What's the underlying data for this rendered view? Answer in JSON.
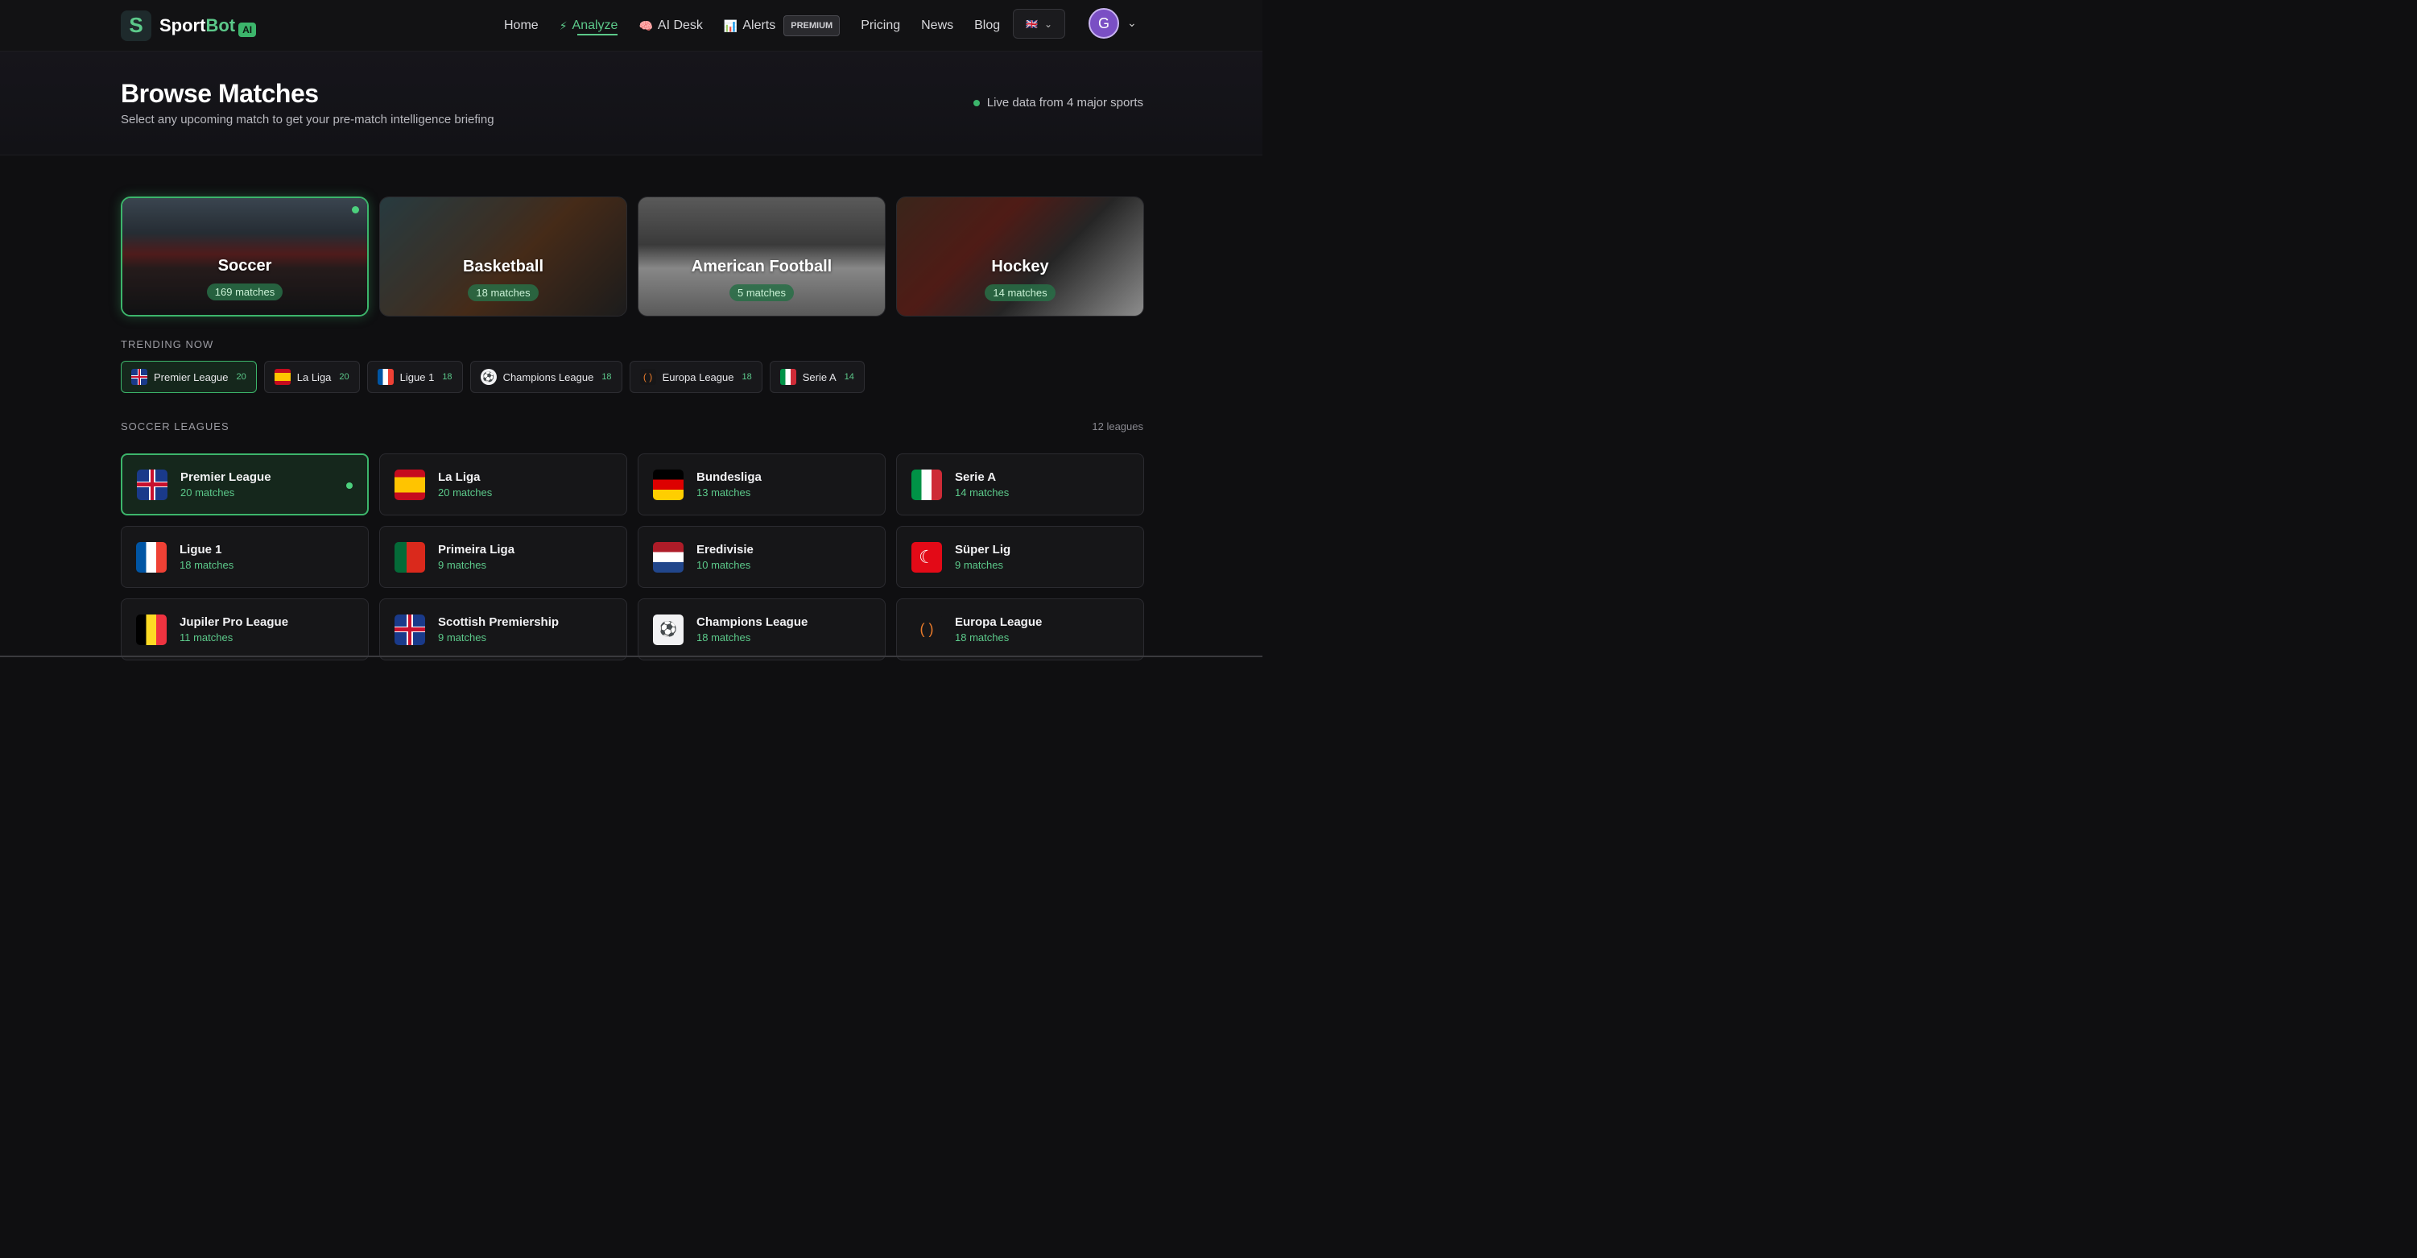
{
  "app": {
    "name_a": "Sport",
    "name_b": "Bot",
    "badge": "AI",
    "logo_glyph": "S"
  },
  "nav": {
    "items": [
      {
        "label": "Home",
        "icon": ""
      },
      {
        "label": "Analyze",
        "icon": "⚡"
      },
      {
        "label": "AI Desk",
        "icon": "🧠"
      },
      {
        "label": "Alerts",
        "icon": "📊"
      },
      {
        "label": "Pricing",
        "icon": ""
      },
      {
        "label": "News",
        "icon": ""
      },
      {
        "label": "Blog",
        "icon": ""
      }
    ],
    "active": "Analyze",
    "premium_badge": "PREMIUM",
    "language_flag": "🇬🇧",
    "avatar_initial": "G"
  },
  "hero": {
    "title": "Browse Matches",
    "subtitle": "Select any upcoming match to get your pre-match intelligence briefing",
    "live_text": "Live data from 4 major sports"
  },
  "sports": [
    {
      "name": "Soccer",
      "count": "169 matches",
      "active": true
    },
    {
      "name": "Basketball",
      "count": "18 matches",
      "active": false
    },
    {
      "name": "American Football",
      "count": "5 matches",
      "active": false
    },
    {
      "name": "Hockey",
      "count": "14 matches",
      "active": false
    }
  ],
  "trending": {
    "label": "TRENDING NOW",
    "chips": [
      {
        "name": "Premier League",
        "count": "20",
        "flag": "uk"
      },
      {
        "name": "La Liga",
        "count": "20",
        "flag": "es"
      },
      {
        "name": "Ligue 1",
        "count": "18",
        "flag": "fr"
      },
      {
        "name": "Champions League",
        "count": "18",
        "flag": "cl"
      },
      {
        "name": "Europa League",
        "count": "18",
        "flag": "el"
      },
      {
        "name": "Serie A",
        "count": "14",
        "flag": "it"
      }
    ]
  },
  "leagues": {
    "label": "SOCCER LEAGUES",
    "count_text": "12 leagues",
    "items": [
      {
        "name": "Premier League",
        "matches": "20 matches",
        "flag": "uk"
      },
      {
        "name": "La Liga",
        "matches": "20 matches",
        "flag": "es"
      },
      {
        "name": "Bundesliga",
        "matches": "13 matches",
        "flag": "de"
      },
      {
        "name": "Serie A",
        "matches": "14 matches",
        "flag": "it"
      },
      {
        "name": "Ligue 1",
        "matches": "18 matches",
        "flag": "fr"
      },
      {
        "name": "Primeira Liga",
        "matches": "9 matches",
        "flag": "pt"
      },
      {
        "name": "Eredivisie",
        "matches": "10 matches",
        "flag": "nl"
      },
      {
        "name": "Süper Lig",
        "matches": "9 matches",
        "flag": "tr"
      },
      {
        "name": "Jupiler Pro League",
        "matches": "11 matches",
        "flag": "be"
      },
      {
        "name": "Scottish Premiership",
        "matches": "9 matches",
        "flag": "uk"
      },
      {
        "name": "Champions League",
        "matches": "18 matches",
        "flag": "cl"
      },
      {
        "name": "Europa League",
        "matches": "18 matches",
        "flag": "el"
      }
    ]
  },
  "colors": {
    "accent": "#3cb56b",
    "accent_text": "#5cc98a",
    "background": "#0f0f11"
  }
}
